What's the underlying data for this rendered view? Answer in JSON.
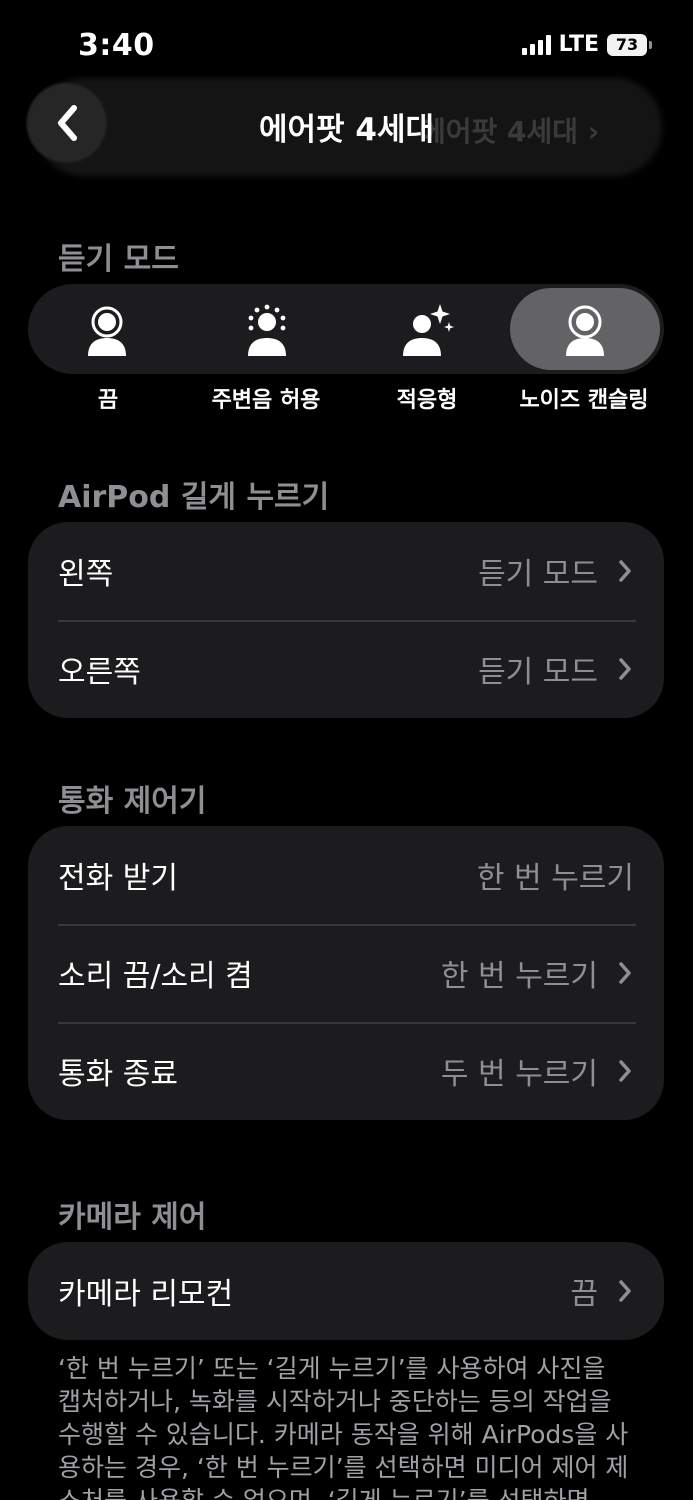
{
  "status_bar": {
    "time": "3:40",
    "network": "LTE",
    "battery": "73"
  },
  "nav": {
    "title": "에어팟 4세대",
    "ghost_text": "에어팟 4세대 ›"
  },
  "listening_mode": {
    "header": "듣기 모드",
    "selected": "노이즈 캔슬링",
    "options": [
      {
        "label": "끔",
        "icon": "person-off-icon"
      },
      {
        "label": "주변음 허용",
        "icon": "transparency-icon"
      },
      {
        "label": "적응형",
        "icon": "adaptive-icon"
      },
      {
        "label": "노이즈 캔슬링",
        "icon": "noise-cancellation-icon"
      }
    ]
  },
  "press_hold": {
    "header": "AirPod 길게 누르기",
    "rows": [
      {
        "label": "왼쪽",
        "value": "듣기 모드"
      },
      {
        "label": "오른쪽",
        "value": "듣기 모드"
      }
    ]
  },
  "call_controls": {
    "header": "통화 제어기",
    "rows": [
      {
        "label": "전화 받기",
        "value": "한 번 누르기"
      },
      {
        "label": "소리 끔/소리 켬",
        "value": "한 번 누르기"
      },
      {
        "label": "통화 종료",
        "value": "두 번 누르기"
      }
    ]
  },
  "camera_control": {
    "header": "카메라 제어",
    "rows": [
      {
        "label": "카메라 리모컨",
        "value": "끔"
      }
    ],
    "note": "‘한 번 누르기’ 또는 ‘길게 누르기’를 사용하여 사진을 캡처하거나, 녹화를 시작하거나 중단하는 등의 작업을 수행할 수 있습니다. 카메라 동작을 위해 AirPods을 사용하는 경우, ‘한 번 누르기’를 선택하면 미디어 제어 제스처를 사용할 수 없으며, ‘길게 누르기’를 선택하면"
  },
  "colors": {
    "background": "#000000",
    "cell": "#1c1c1e",
    "secondary_text": "#8e8e93",
    "selected_pill": "#636366"
  }
}
